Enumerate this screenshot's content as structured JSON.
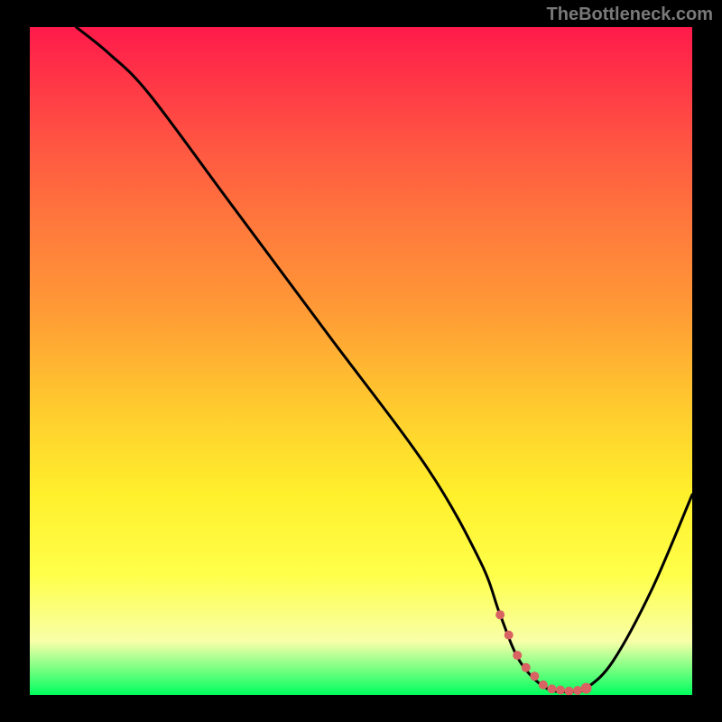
{
  "watermark": "TheBottleneck.com",
  "chart_data": {
    "type": "line",
    "title": "",
    "xlabel": "",
    "ylabel": "",
    "xlim": [
      0,
      100
    ],
    "ylim": [
      0,
      100
    ],
    "series": [
      {
        "name": "curve",
        "x": [
          7,
          12,
          18,
          30,
          45,
          60,
          68,
          71,
          74,
          78,
          82,
          84,
          88,
          94,
          100
        ],
        "values": [
          100,
          96,
          90,
          74,
          54,
          34,
          20,
          12,
          5,
          1,
          0.5,
          1,
          5,
          16,
          30
        ]
      }
    ],
    "flat_region": {
      "x_start": 71,
      "x_end": 84
    },
    "flat_dot_color": "#d96262",
    "curve_color": "#000000",
    "gradient_stops": [
      {
        "pos": 0,
        "color": "#ff1a4b"
      },
      {
        "pos": 8,
        "color": "#ff3647"
      },
      {
        "pos": 18,
        "color": "#ff5742"
      },
      {
        "pos": 30,
        "color": "#ff7a3c"
      },
      {
        "pos": 42,
        "color": "#ff9936"
      },
      {
        "pos": 58,
        "color": "#ffce2e"
      },
      {
        "pos": 70,
        "color": "#fff02c"
      },
      {
        "pos": 82,
        "color": "#ffff4a"
      },
      {
        "pos": 92,
        "color": "#f8ffa8"
      },
      {
        "pos": 100,
        "color": "#00ff5e"
      }
    ]
  }
}
